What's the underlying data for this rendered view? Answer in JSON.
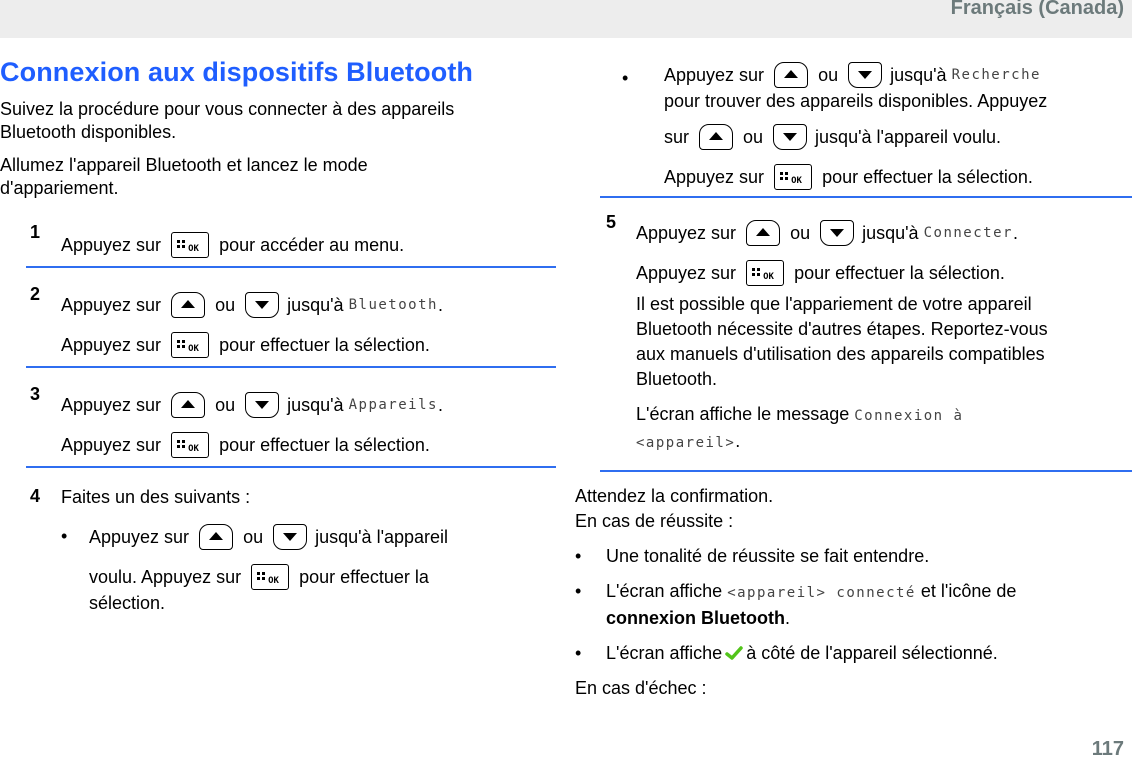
{
  "header": {
    "language": "Français (Canada)"
  },
  "footer": {
    "page_number": "117"
  },
  "left": {
    "title": "Connexion aux dispositifs Bluetooth",
    "intro_1": "Suivez la procédure pour vous connecter à des appareils Bluetooth disponibles.",
    "intro_1a": "Suivez la procédure pour vous connecter à des appareils",
    "intro_1b": "Bluetooth disponibles.",
    "intro_2a": "Allumez l'appareil Bluetooth et lancez le mode",
    "intro_2b": "d'appariement.",
    "steps": [
      {
        "number": "1",
        "press": "Appuyez sur",
        "after_ok": "pour accéder au menu."
      },
      {
        "number": "2",
        "press": "Appuyez sur",
        "or": "ou",
        "until": "jusqu'à",
        "screen_item": "Bluetooth",
        "period": ".",
        "press2": "Appuyez sur",
        "after_ok": "pour effectuer la sélection."
      },
      {
        "number": "3",
        "press": "Appuyez sur",
        "or": "ou",
        "until": "jusqu'à",
        "screen_item": "Appareils",
        "period": ".",
        "press2": "Appuyez sur",
        "after_ok": "pour effectuer la sélection."
      },
      {
        "number": "4",
        "text": "Faites un des suivants :",
        "bullet": {
          "press": "Appuyez sur",
          "or": "ou",
          "until_a": "jusqu'à l'appareil",
          "until_b": "voulu. Appuyez sur",
          "after_ok_a": "pour effectuer la",
          "after_ok_b": "sélection."
        }
      }
    ]
  },
  "right": {
    "bullet2": {
      "press": "Appuyez sur",
      "or": "ou",
      "until": "jusqu'à",
      "screen_item": "Recherche",
      "line2": "pour trouver des appareils disponibles. Appuyez",
      "sur": "sur",
      "or2": "ou",
      "until2": "jusqu'à l'appareil voulu.",
      "press3": "Appuyez sur",
      "after_ok": "pour effectuer la sélection."
    },
    "step5": {
      "number": "5",
      "press": "Appuyez sur",
      "or": "ou",
      "until": "jusqu'à",
      "screen_item": "Connecter",
      "period": ".",
      "press2": "Appuyez sur",
      "after_ok": "pour effectuer la sélection.",
      "note_lines": [
        "Il est possible que l'appariement de votre appareil",
        "Bluetooth nécessite d'autres étapes. Reportez-vous",
        "aux manuels d'utilisation des appareils compatibles",
        "Bluetooth."
      ],
      "msg_prefix": "L'écran affiche le message",
      "msg_screen_1": "Connexion à",
      "msg_screen_2": "<appareil>",
      "msg_period": "."
    },
    "wait": "Attendez la confirmation.",
    "success_label": "En cas de réussite :",
    "success_items": [
      {
        "text": "Une tonalité de réussite se fait entendre."
      },
      {
        "prefix": "L'écran affiche",
        "screen": "<appareil> connecté",
        "suffix": "et l'icône de",
        "bold": "connexion Bluetooth",
        "end": "."
      },
      {
        "prefix": "L'écran affiche",
        "icon": "check-icon",
        "suffix": "à côté de l'appareil sélectionné."
      }
    ],
    "failure_label": "En cas d'échec :"
  },
  "icons": {
    "ok_button": "menu-ok-button-icon",
    "up_button": "up-arrow-button-icon",
    "down_button": "down-arrow-button-icon",
    "ok_text": "OK"
  },
  "colors": {
    "title": "#1f5eff",
    "rule": "#2f6ef0",
    "header_text": "#6c7a7b",
    "header_bg": "#ededed",
    "check": "#52c41a"
  }
}
